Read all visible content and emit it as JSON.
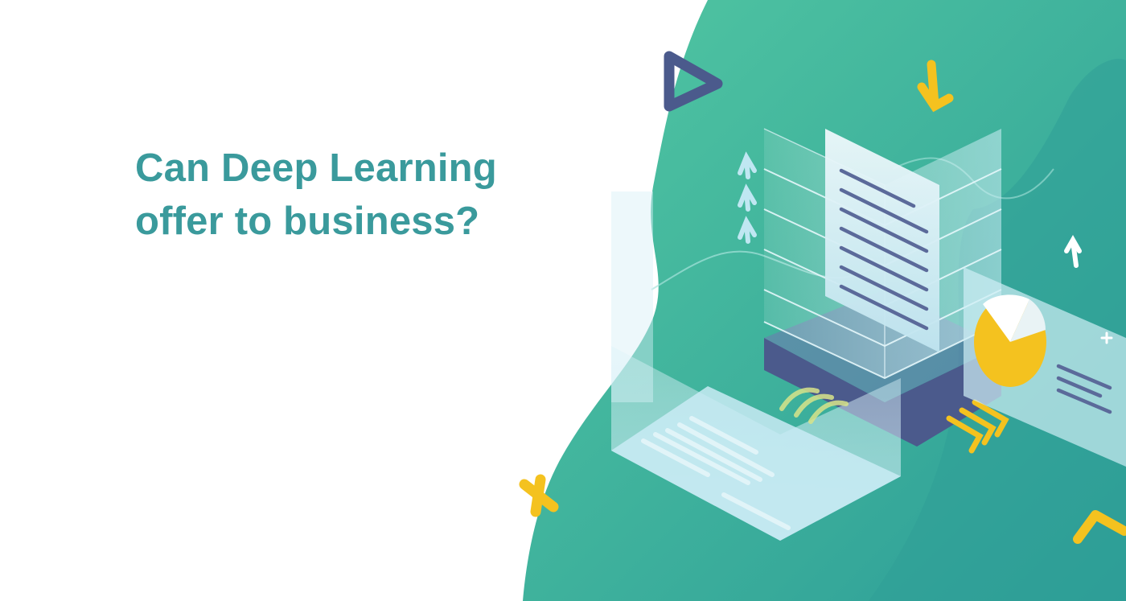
{
  "headline": {
    "line1": "Can Deep Learning",
    "line2": "offer to business?"
  },
  "colors": {
    "headline": "#3a9a9c",
    "blob_light": "#4ec3a0",
    "blob_dark": "#2f9f98",
    "accent_yellow": "#f4c21f",
    "accent_navy": "#4b5a8c",
    "glass": "#bfe6f0",
    "document_line": "#5b6a9a"
  },
  "icons": [
    "play-triangle-icon",
    "down-arrow-icon",
    "up-arrow-icon",
    "plus-icon",
    "cross-icon",
    "chevron-icon",
    "pie-chart-icon",
    "document-icon"
  ]
}
